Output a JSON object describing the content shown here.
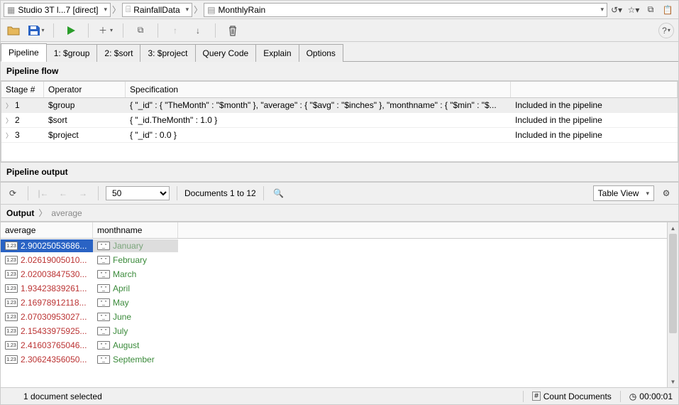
{
  "topbar": {
    "connection": "Studio 3T l...7 [direct]",
    "database": "RainfallData",
    "collection": "MonthlyRain"
  },
  "tabs": [
    {
      "label": "Pipeline",
      "active": true
    },
    {
      "label": "1: $group",
      "active": false
    },
    {
      "label": "2: $sort",
      "active": false
    },
    {
      "label": "3: $project",
      "active": false
    },
    {
      "label": "Query Code",
      "active": false
    },
    {
      "label": "Explain",
      "active": false
    },
    {
      "label": "Options",
      "active": false
    }
  ],
  "sections": {
    "pipeline_flow": "Pipeline flow",
    "pipeline_output": "Pipeline output"
  },
  "flow": {
    "head": {
      "stage": "Stage #",
      "operator": "Operator",
      "spec": "Specification",
      "status": ""
    },
    "rows": [
      {
        "n": "1",
        "op": "$group",
        "spec": "{ \"_id\" : { \"TheMonth\" : \"$month\" }, \"average\" : { \"$avg\" : \"$inches\" }, \"monthname\" : { \"$min\" : \"$...",
        "status": "Included in the pipeline",
        "sel": true
      },
      {
        "n": "2",
        "op": "$sort",
        "spec": "{ \"_id.TheMonth\" : 1.0 }",
        "status": "Included in the pipeline",
        "sel": false
      },
      {
        "n": "3",
        "op": "$project",
        "spec": "{ \"_id\" : 0.0 }",
        "status": "Included in the pipeline",
        "sel": false
      }
    ]
  },
  "output_bar": {
    "page_size": "50",
    "docs_label": "Documents 1 to 12",
    "view": "Table View"
  },
  "breadcrumb": {
    "root": "Output",
    "leaf": "average"
  },
  "table": {
    "head": {
      "avg": "average",
      "month": "monthname"
    },
    "rows": [
      {
        "avg": "2.90025053686...",
        "month": "January",
        "selected": true
      },
      {
        "avg": "2.02619005010...",
        "month": "February",
        "selected": false
      },
      {
        "avg": "2.02003847530...",
        "month": "March",
        "selected": false
      },
      {
        "avg": "1.93423839261...",
        "month": "April",
        "selected": false
      },
      {
        "avg": "2.16978912118...",
        "month": "May",
        "selected": false
      },
      {
        "avg": "2.07030953027...",
        "month": "June",
        "selected": false
      },
      {
        "avg": "2.15433975925...",
        "month": "July",
        "selected": false
      },
      {
        "avg": "2.41603765046...",
        "month": "August",
        "selected": false
      },
      {
        "avg": "2.30624356050...",
        "month": "September",
        "selected": false
      }
    ],
    "badges": {
      "num": "1.23",
      "str": "\"_\""
    }
  },
  "status": {
    "selection": "1 document selected",
    "count_btn": "Count Documents",
    "timer": "00:00:01"
  }
}
